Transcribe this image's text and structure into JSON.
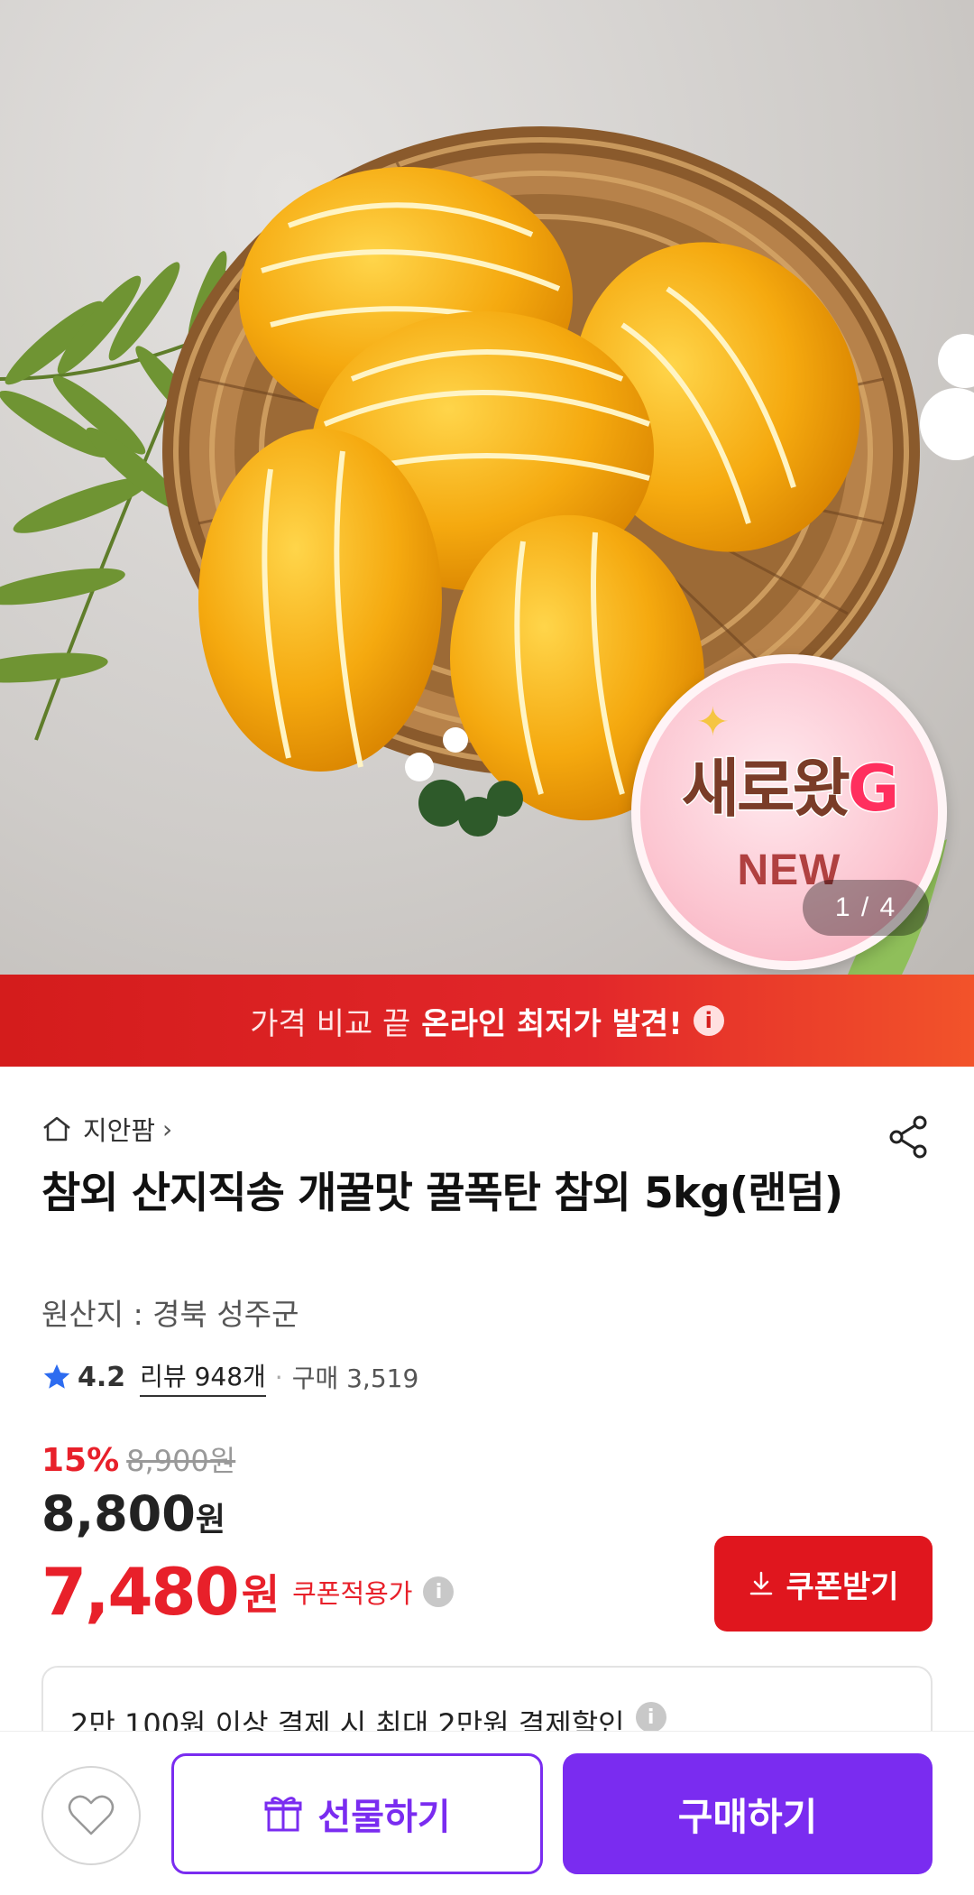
{
  "hero": {
    "badge_title_main": "새로왔",
    "badge_title_letter": "G",
    "badge_subtitle": "NEW",
    "pager": "1 / 4"
  },
  "promo_bar": {
    "text_prefix": "가격 비교 끝",
    "text_bold": "온라인 최저가 발견!",
    "info_glyph": "i"
  },
  "product": {
    "store_name": "지안팜",
    "title": "참외 산지직송 개꿀맛 꿀폭탄 참외 5kg(랜덤)",
    "origin": "원산지 : 경북 성주군",
    "rating": "4.2",
    "review_text": "리뷰 948개",
    "purchase_text": "구매 3,519",
    "discount_rate": "15%",
    "original_price": "8,900원",
    "price_number": "8,800",
    "price_unit": "원",
    "coupon_price_number": "7,480",
    "coupon_price_unit": "원",
    "coupon_label": "쿠폰적용가",
    "coupon_button_label": "쿠폰받기",
    "payment_discount_text": "2만 100원 이상 결제 시 최대 2만원 결제할인"
  },
  "bottom_bar": {
    "gift_label": "선물하기",
    "buy_label": "구매하기"
  },
  "colors": {
    "accent_red": "#e0161e",
    "purple": "#7a2cf0",
    "promo_red": "#d41c1c"
  },
  "icons": [
    "home-icon",
    "chevron-right-icon",
    "share-icon",
    "star-icon",
    "info-icon",
    "download-icon",
    "heart-icon",
    "gift-icon"
  ]
}
